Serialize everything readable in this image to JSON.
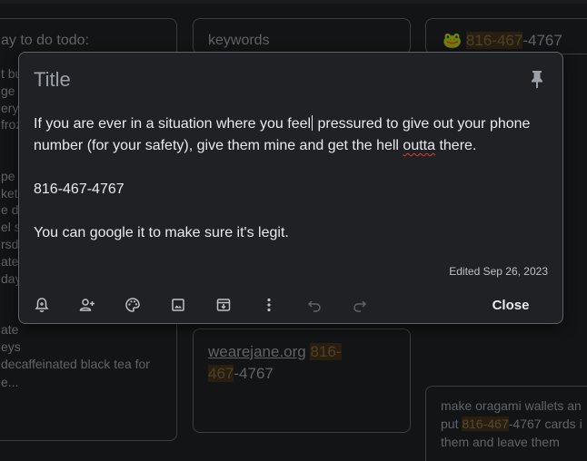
{
  "background": {
    "card1": {
      "title": "ay to do todo:",
      "lines": [
        "t bu",
        "ge",
        "ery",
        "froz",
        "",
        "",
        "pe",
        "ket",
        "e do",
        "el s",
        "rsda",
        "ate",
        "day",
        "",
        "",
        "ate",
        "eys"
      ],
      "footer_line1": "decaffeinated black tea for",
      "footer_line2": "e..."
    },
    "card2": {
      "title": "keywords"
    },
    "card3": {
      "emoji": "🐸",
      "phone_a": "816",
      "phone_dash1": "-",
      "phone_b": "467",
      "phone_rest": "-4767"
    },
    "card4": {
      "link": "wearejane.org",
      "space": " ",
      "phone_a": "816-",
      "phone_b": "467",
      "phone_rest": "-4767"
    },
    "card5": {
      "line1": "make oragami wallets an",
      "line2_pre": "put ",
      "line2_hl1": "816-467",
      "line2_post": "-4767 cards i",
      "line3": "them and leave them"
    }
  },
  "note": {
    "title_placeholder": "Title",
    "body": {
      "line1_a": "If you are ever in a situation where you feel",
      "line1_b": " pressured to give out your phone",
      "line2_a": "number (for your safety), give them mine and get the hell ",
      "line2_misspelled": "outta",
      "line2_b": " there.",
      "line3": "816-467-4767",
      "line4": "You can google it to make sure it's legit."
    },
    "edited": "Edited Sep 26, 2023",
    "close_label": "Close",
    "toolbar": [
      "bell-plus-icon",
      "person-add-icon",
      "palette-icon",
      "image-icon",
      "archive-icon",
      "more-vert-icon",
      "undo-icon",
      "redo-icon"
    ]
  },
  "colors": {
    "background": "#202124",
    "border": "#5f6368",
    "highlight": "#41331c",
    "text": "#e8eaed"
  }
}
